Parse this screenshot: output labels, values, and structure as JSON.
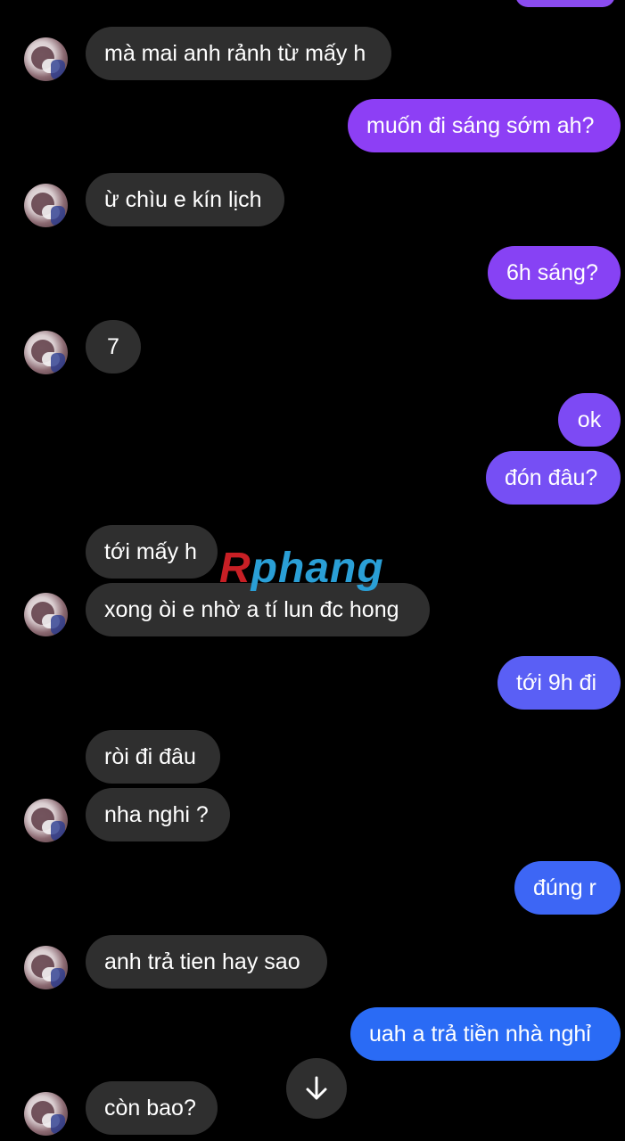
{
  "colors": {
    "incoming_bubble": "#2f2f2f",
    "outgoing_top": "#8b3ff5",
    "outgoing_bottom": "#1f6bf5",
    "background": "#000000",
    "text": "#ffffff"
  },
  "messages": [
    {
      "from": "them",
      "text": "mà mai anh rảnh từ mấy h"
    },
    {
      "from": "me",
      "text": "muốn đi sáng sớm ah?"
    },
    {
      "from": "them",
      "text": "ừ chìu e kín lịch"
    },
    {
      "from": "me",
      "text": "6h sáng?"
    },
    {
      "from": "them",
      "text": "7"
    },
    {
      "from": "me",
      "text": "ok"
    },
    {
      "from": "me",
      "text": "đón đâu?"
    },
    {
      "from": "them",
      "text": "tới mấy h"
    },
    {
      "from": "them",
      "text": "xong òi e nhờ a tí lun đc hong"
    },
    {
      "from": "me",
      "text": "tới 9h đi"
    },
    {
      "from": "them",
      "text": "ròi đi đâu"
    },
    {
      "from": "them",
      "text": "nha nghi ?"
    },
    {
      "from": "me",
      "text": "đúng r"
    },
    {
      "from": "them",
      "text": "anh trả tien hay sao"
    },
    {
      "from": "me",
      "text": "uah a trả tiền nhà nghỉ"
    },
    {
      "from": "them",
      "text": "còn bao?"
    }
  ],
  "watermark": {
    "first": "R",
    "rest": "phang"
  },
  "icons": {
    "scroll_down": "arrow-down-icon",
    "avatar": "contact-avatar"
  }
}
